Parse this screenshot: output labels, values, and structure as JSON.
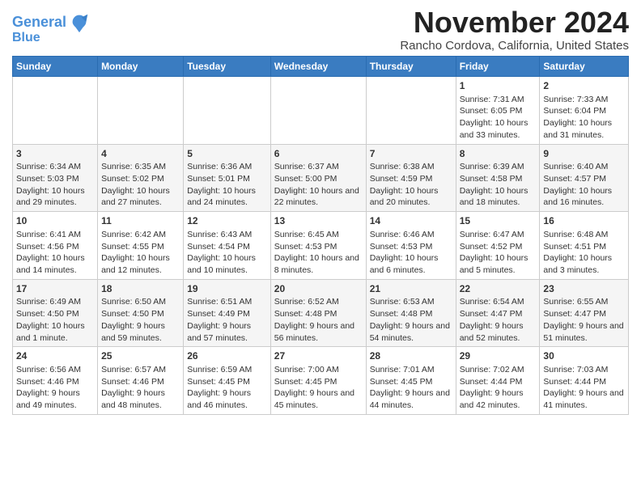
{
  "logo": {
    "line1": "General",
    "line2": "Blue"
  },
  "title": "November 2024",
  "subtitle": "Rancho Cordova, California, United States",
  "days_of_week": [
    "Sunday",
    "Monday",
    "Tuesday",
    "Wednesday",
    "Thursday",
    "Friday",
    "Saturday"
  ],
  "weeks": [
    [
      {
        "day": "",
        "sunrise": "",
        "sunset": "",
        "daylight": ""
      },
      {
        "day": "",
        "sunrise": "",
        "sunset": "",
        "daylight": ""
      },
      {
        "day": "",
        "sunrise": "",
        "sunset": "",
        "daylight": ""
      },
      {
        "day": "",
        "sunrise": "",
        "sunset": "",
        "daylight": ""
      },
      {
        "day": "",
        "sunrise": "",
        "sunset": "",
        "daylight": ""
      },
      {
        "day": "1",
        "sunrise": "Sunrise: 7:31 AM",
        "sunset": "Sunset: 6:05 PM",
        "daylight": "Daylight: 10 hours and 33 minutes."
      },
      {
        "day": "2",
        "sunrise": "Sunrise: 7:33 AM",
        "sunset": "Sunset: 6:04 PM",
        "daylight": "Daylight: 10 hours and 31 minutes."
      }
    ],
    [
      {
        "day": "3",
        "sunrise": "Sunrise: 6:34 AM",
        "sunset": "Sunset: 5:03 PM",
        "daylight": "Daylight: 10 hours and 29 minutes."
      },
      {
        "day": "4",
        "sunrise": "Sunrise: 6:35 AM",
        "sunset": "Sunset: 5:02 PM",
        "daylight": "Daylight: 10 hours and 27 minutes."
      },
      {
        "day": "5",
        "sunrise": "Sunrise: 6:36 AM",
        "sunset": "Sunset: 5:01 PM",
        "daylight": "Daylight: 10 hours and 24 minutes."
      },
      {
        "day": "6",
        "sunrise": "Sunrise: 6:37 AM",
        "sunset": "Sunset: 5:00 PM",
        "daylight": "Daylight: 10 hours and 22 minutes."
      },
      {
        "day": "7",
        "sunrise": "Sunrise: 6:38 AM",
        "sunset": "Sunset: 4:59 PM",
        "daylight": "Daylight: 10 hours and 20 minutes."
      },
      {
        "day": "8",
        "sunrise": "Sunrise: 6:39 AM",
        "sunset": "Sunset: 4:58 PM",
        "daylight": "Daylight: 10 hours and 18 minutes."
      },
      {
        "day": "9",
        "sunrise": "Sunrise: 6:40 AM",
        "sunset": "Sunset: 4:57 PM",
        "daylight": "Daylight: 10 hours and 16 minutes."
      }
    ],
    [
      {
        "day": "10",
        "sunrise": "Sunrise: 6:41 AM",
        "sunset": "Sunset: 4:56 PM",
        "daylight": "Daylight: 10 hours and 14 minutes."
      },
      {
        "day": "11",
        "sunrise": "Sunrise: 6:42 AM",
        "sunset": "Sunset: 4:55 PM",
        "daylight": "Daylight: 10 hours and 12 minutes."
      },
      {
        "day": "12",
        "sunrise": "Sunrise: 6:43 AM",
        "sunset": "Sunset: 4:54 PM",
        "daylight": "Daylight: 10 hours and 10 minutes."
      },
      {
        "day": "13",
        "sunrise": "Sunrise: 6:45 AM",
        "sunset": "Sunset: 4:53 PM",
        "daylight": "Daylight: 10 hours and 8 minutes."
      },
      {
        "day": "14",
        "sunrise": "Sunrise: 6:46 AM",
        "sunset": "Sunset: 4:53 PM",
        "daylight": "Daylight: 10 hours and 6 minutes."
      },
      {
        "day": "15",
        "sunrise": "Sunrise: 6:47 AM",
        "sunset": "Sunset: 4:52 PM",
        "daylight": "Daylight: 10 hours and 5 minutes."
      },
      {
        "day": "16",
        "sunrise": "Sunrise: 6:48 AM",
        "sunset": "Sunset: 4:51 PM",
        "daylight": "Daylight: 10 hours and 3 minutes."
      }
    ],
    [
      {
        "day": "17",
        "sunrise": "Sunrise: 6:49 AM",
        "sunset": "Sunset: 4:50 PM",
        "daylight": "Daylight: 10 hours and 1 minute."
      },
      {
        "day": "18",
        "sunrise": "Sunrise: 6:50 AM",
        "sunset": "Sunset: 4:50 PM",
        "daylight": "Daylight: 9 hours and 59 minutes."
      },
      {
        "day": "19",
        "sunrise": "Sunrise: 6:51 AM",
        "sunset": "Sunset: 4:49 PM",
        "daylight": "Daylight: 9 hours and 57 minutes."
      },
      {
        "day": "20",
        "sunrise": "Sunrise: 6:52 AM",
        "sunset": "Sunset: 4:48 PM",
        "daylight": "Daylight: 9 hours and 56 minutes."
      },
      {
        "day": "21",
        "sunrise": "Sunrise: 6:53 AM",
        "sunset": "Sunset: 4:48 PM",
        "daylight": "Daylight: 9 hours and 54 minutes."
      },
      {
        "day": "22",
        "sunrise": "Sunrise: 6:54 AM",
        "sunset": "Sunset: 4:47 PM",
        "daylight": "Daylight: 9 hours and 52 minutes."
      },
      {
        "day": "23",
        "sunrise": "Sunrise: 6:55 AM",
        "sunset": "Sunset: 4:47 PM",
        "daylight": "Daylight: 9 hours and 51 minutes."
      }
    ],
    [
      {
        "day": "24",
        "sunrise": "Sunrise: 6:56 AM",
        "sunset": "Sunset: 4:46 PM",
        "daylight": "Daylight: 9 hours and 49 minutes."
      },
      {
        "day": "25",
        "sunrise": "Sunrise: 6:57 AM",
        "sunset": "Sunset: 4:46 PM",
        "daylight": "Daylight: 9 hours and 48 minutes."
      },
      {
        "day": "26",
        "sunrise": "Sunrise: 6:59 AM",
        "sunset": "Sunset: 4:45 PM",
        "daylight": "Daylight: 9 hours and 46 minutes."
      },
      {
        "day": "27",
        "sunrise": "Sunrise: 7:00 AM",
        "sunset": "Sunset: 4:45 PM",
        "daylight": "Daylight: 9 hours and 45 minutes."
      },
      {
        "day": "28",
        "sunrise": "Sunrise: 7:01 AM",
        "sunset": "Sunset: 4:45 PM",
        "daylight": "Daylight: 9 hours and 44 minutes."
      },
      {
        "day": "29",
        "sunrise": "Sunrise: 7:02 AM",
        "sunset": "Sunset: 4:44 PM",
        "daylight": "Daylight: 9 hours and 42 minutes."
      },
      {
        "day": "30",
        "sunrise": "Sunrise: 7:03 AM",
        "sunset": "Sunset: 4:44 PM",
        "daylight": "Daylight: 9 hours and 41 minutes."
      }
    ]
  ]
}
